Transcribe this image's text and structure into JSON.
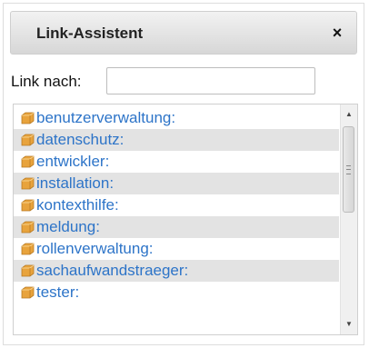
{
  "dialog": {
    "title": "Link-Assistent",
    "close_glyph": "×"
  },
  "link": {
    "label": "Link nach:",
    "value": "",
    "placeholder": ""
  },
  "namespaces": {
    "icon": "namespace-folder-icon",
    "icon_color": "#e8a33c",
    "link_color": "#2d74c8",
    "items": [
      {
        "label": "benutzerverwaltung:"
      },
      {
        "label": "datenschutz:"
      },
      {
        "label": "entwickler:"
      },
      {
        "label": "installation:"
      },
      {
        "label": "kontexthilfe:"
      },
      {
        "label": "meldung:"
      },
      {
        "label": "rollenverwaltung:"
      },
      {
        "label": "sachaufwandstraeger:"
      },
      {
        "label": "tester:"
      }
    ]
  },
  "scrollbar": {
    "up_glyph": "▲",
    "down_glyph": "▼"
  }
}
